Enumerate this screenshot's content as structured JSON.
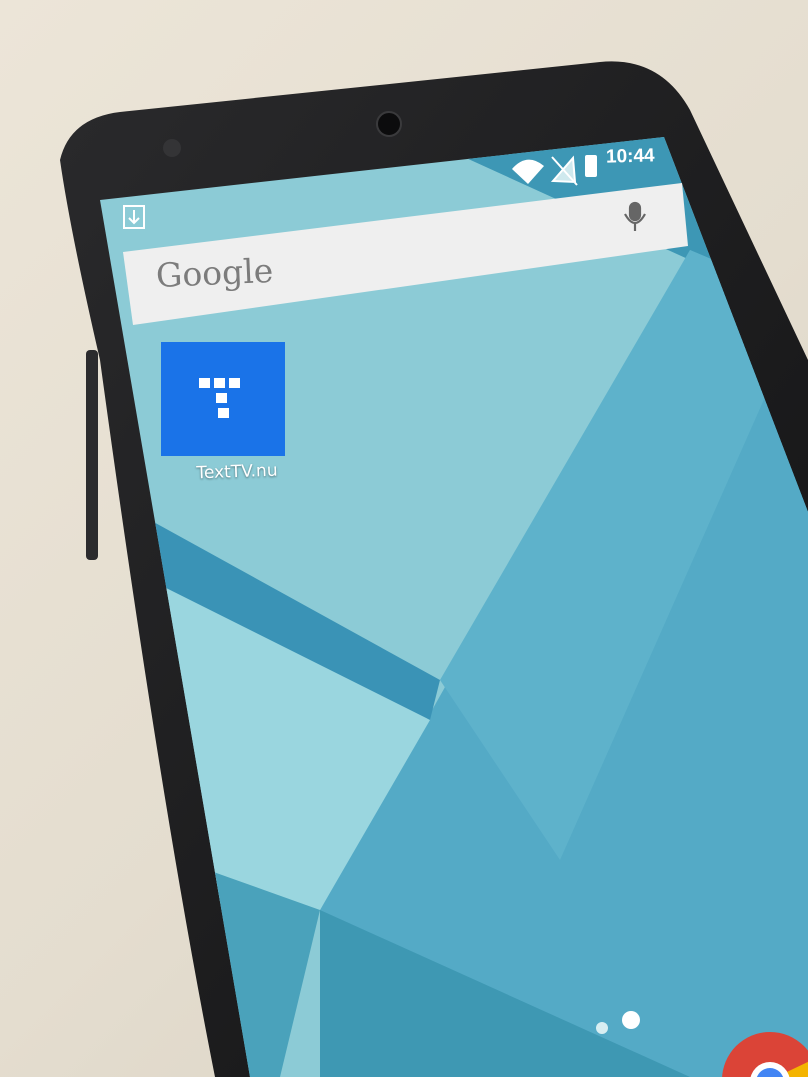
{
  "status_bar": {
    "time": "10:44",
    "icons": [
      "download-notification-icon",
      "wifi-icon",
      "no-signal-icon",
      "battery-icon"
    ]
  },
  "search_widget": {
    "logo_text": "Google",
    "mic_icon": "mic-icon"
  },
  "home": {
    "apps": [
      {
        "label": "TextTV.nu",
        "icon": "texttv-app-icon",
        "color": "#1a73e8"
      }
    ],
    "page_indicator": {
      "pages": 2,
      "current": 2
    },
    "dock_partial_icon": "chrome-icon"
  },
  "colors": {
    "wallpaper_light": "#9ed3dc",
    "wallpaper_mid": "#58afc6",
    "wallpaper_dark": "#2f8fae",
    "phone_body": "#1b1b1c"
  }
}
